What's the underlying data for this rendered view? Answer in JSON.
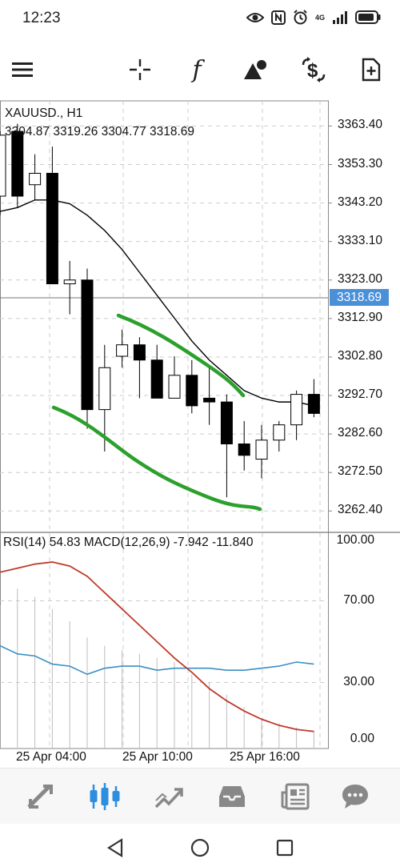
{
  "status": {
    "time": "12:23",
    "network": "4G",
    "icons": [
      "eye-icon",
      "nfc-icon",
      "alarm-icon",
      "signal-icon",
      "battery-icon"
    ]
  },
  "toolbar": {
    "items": [
      "menu-icon",
      "crosshair-icon",
      "indicators-icon",
      "objects-icon",
      "symbol-icon",
      "new-order-icon"
    ],
    "indicators_glyph": "f"
  },
  "chart": {
    "symbol": "XAUUSD., H1",
    "ohlc": "3304.87 3319.26 3304.77 3318.69",
    "price_axis": [
      "3363.40",
      "3353.30",
      "3343.20",
      "3333.10",
      "3323.00",
      "3312.90",
      "3302.80",
      "3292.70",
      "3282.60",
      "3272.50",
      "3262.40"
    ],
    "current_price": "3318.69",
    "indicator_label": "RSI(14) 54.83 MACD(12,26,9) -7.942 -11.840",
    "indicator_axis": [
      "100.00",
      "70.00",
      "30.00",
      "0.00"
    ],
    "time_axis": [
      "25 Apr 04:00",
      "25 Apr 10:00",
      "25 Apr 16:00"
    ],
    "colors": {
      "bull_body": "#ffffff",
      "bear_body": "#000000",
      "moving_average": "#000000",
      "highlight": "#2ca02c",
      "price_tag": "#4a90d9",
      "rsi": "#3b8fc4",
      "signal": "#c0392b",
      "histogram": "#bdbdbd"
    }
  },
  "chart_data": {
    "type": "candlestick",
    "candles": [
      {
        "o": 3345,
        "h": 3362,
        "l": 3340,
        "c": 3361
      },
      {
        "o": 3362,
        "h": 3364,
        "l": 3342,
        "c": 3345
      },
      {
        "o": 3348,
        "h": 3356,
        "l": 3344,
        "c": 3351
      },
      {
        "o": 3351,
        "h": 3358,
        "l": 3322,
        "c": 3322
      },
      {
        "o": 3322,
        "h": 3328,
        "l": 3314,
        "c": 3323
      },
      {
        "o": 3323,
        "h": 3326,
        "l": 3284,
        "c": 3289
      },
      {
        "o": 3289,
        "h": 3306,
        "l": 3278,
        "c": 3300
      },
      {
        "o": 3303,
        "h": 3310,
        "l": 3300,
        "c": 3306
      },
      {
        "o": 3306,
        "h": 3308,
        "l": 3292,
        "c": 3302
      },
      {
        "o": 3302,
        "h": 3306,
        "l": 3292,
        "c": 3292
      },
      {
        "o": 3292,
        "h": 3303,
        "l": 3292,
        "c": 3298
      },
      {
        "o": 3298,
        "h": 3302,
        "l": 3288,
        "c": 3290
      },
      {
        "o": 3292,
        "h": 3300,
        "l": 3285,
        "c": 3291
      },
      {
        "o": 3291,
        "h": 3293,
        "l": 3266,
        "c": 3280
      },
      {
        "o": 3280,
        "h": 3286,
        "l": 3273,
        "c": 3277
      },
      {
        "o": 3276,
        "h": 3285,
        "l": 3271,
        "c": 3281
      },
      {
        "o": 3281,
        "h": 3286,
        "l": 3278,
        "c": 3285
      },
      {
        "o": 3285,
        "h": 3294,
        "l": 3281,
        "c": 3293
      },
      {
        "o": 3293,
        "h": 3297,
        "l": 3287,
        "c": 3288
      }
    ],
    "moving_average": [
      3341,
      3342,
      3344,
      3344,
      3343,
      3340,
      3336,
      3331,
      3325,
      3319,
      3313,
      3307,
      3302,
      3298,
      3294,
      3292,
      3291,
      3291,
      3290
    ],
    "rsi": [
      48,
      44,
      43,
      39,
      38,
      34,
      37,
      38,
      38,
      36,
      37,
      37,
      37,
      36,
      36,
      37,
      38,
      40,
      39
    ],
    "macd_signal": [
      84,
      86,
      88,
      89,
      87,
      82,
      74,
      66,
      58,
      50,
      42,
      35,
      27,
      21,
      16,
      12,
      9,
      7,
      6
    ],
    "macd_histogram": [
      68,
      76,
      72,
      66,
      60,
      52,
      48,
      46,
      44,
      42,
      40,
      34,
      30,
      24,
      18,
      12,
      10,
      8,
      6
    ],
    "ylim": [
      3257,
      3370
    ],
    "indicator_ylim": [
      0,
      100
    ]
  }
}
